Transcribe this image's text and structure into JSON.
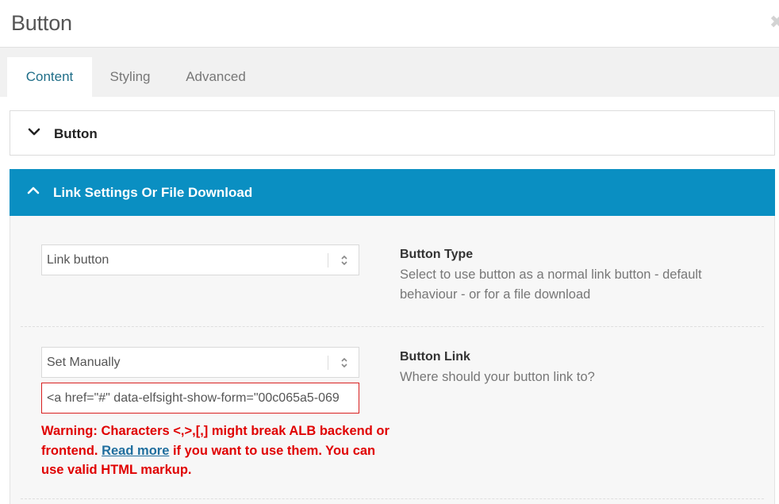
{
  "modal": {
    "title": "Button"
  },
  "tabs": [
    {
      "label": "Content",
      "active": true
    },
    {
      "label": "Styling",
      "active": false
    },
    {
      "label": "Advanced",
      "active": false
    }
  ],
  "sections": {
    "button": {
      "label": "Button",
      "expanded": false
    },
    "link": {
      "label": "Link Settings Or File Download",
      "expanded": true
    }
  },
  "fields": {
    "button_type": {
      "value": "Link button",
      "title": "Button Type",
      "description": "Select to use button as a normal link button - default behaviour - or for a file download"
    },
    "button_link": {
      "value": "Set Manually",
      "input_value": "<a href=\"#\" data-elfsight-show-form=\"00c065a5-069",
      "title": "Button Link",
      "description": "Where should your button link to?"
    }
  },
  "warning": {
    "part1": "Warning: Characters <,>,[,] might break ALB backend or frontend.",
    "link_text": "Read more",
    "part2": "if you want to use them. You can use valid HTML markup."
  },
  "colors": {
    "accent": "#0a8fc2",
    "active_tab_text": "#1f6e88",
    "warning": "#e00000",
    "error_border": "#d81f1f"
  },
  "icons": {
    "close": "close-icon",
    "collapsed": "chevron-down-icon",
    "expanded": "chevron-up-icon",
    "select": "select-arrows-icon"
  }
}
